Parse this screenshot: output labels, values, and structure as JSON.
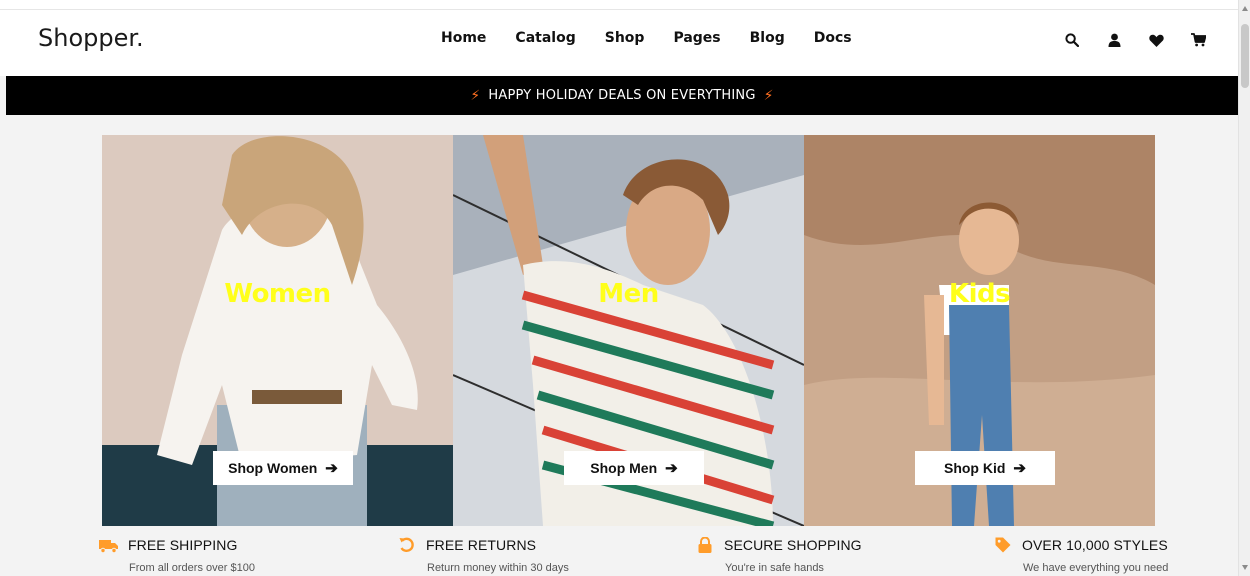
{
  "brand": "Shopper.",
  "nav": [
    "Home",
    "Catalog",
    "Shop",
    "Pages",
    "Blog",
    "Docs"
  ],
  "header_icons": [
    "search-icon",
    "user-icon",
    "heart-icon",
    "cart-icon"
  ],
  "promo": {
    "text": "HAPPY HOLIDAY DEALS ON EVERYTHING",
    "bolt_color": "#ff6f20"
  },
  "categories": [
    {
      "title": "Women",
      "button": "Shop Women"
    },
    {
      "title": "Men",
      "button": "Shop Men"
    },
    {
      "title": "Kids",
      "button": "Shop Kid"
    }
  ],
  "features": [
    {
      "icon": "truck-icon",
      "title": "FREE SHIPPING",
      "subtitle": "From all orders over $100"
    },
    {
      "icon": "return-icon",
      "title": "FREE RETURNS",
      "subtitle": "Return money within 30 days"
    },
    {
      "icon": "lock-icon",
      "title": "SECURE SHOPPING",
      "subtitle": "You're in safe hands"
    },
    {
      "icon": "tag-icon",
      "title": "OVER 10,000 STYLES",
      "subtitle": "We have everything you need"
    }
  ],
  "colors": {
    "accent": "#ff9c2a",
    "title_yellow": "#ffff1a"
  }
}
